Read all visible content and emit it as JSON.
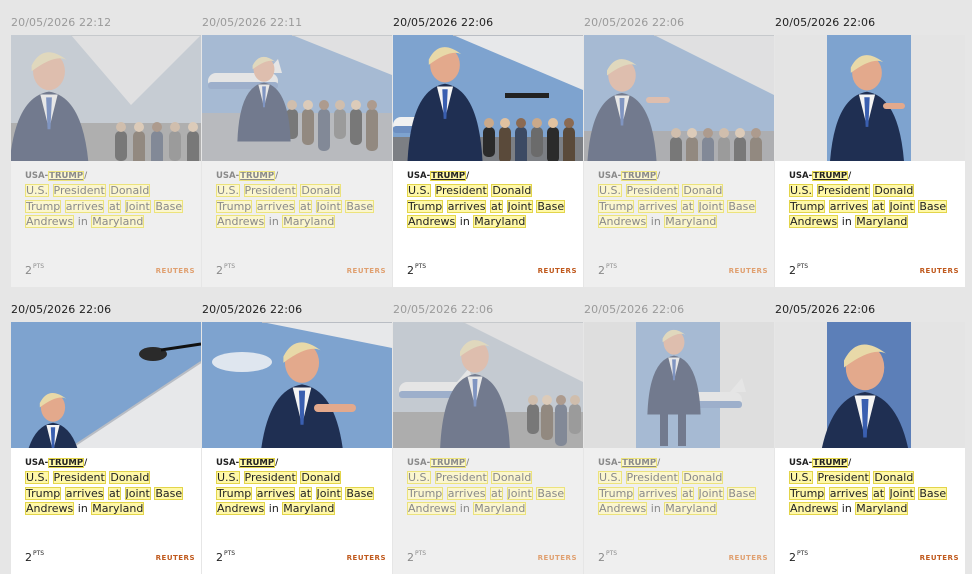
{
  "cards": [
    {
      "timestamp": "20/05/2026 22:12",
      "dimmed": true,
      "photo": "trump-closeup-reporters"
    },
    {
      "timestamp": "20/05/2026 22:11",
      "dimmed": true,
      "photo": "trump-tarmac-press-wide"
    },
    {
      "timestamp": "20/05/2026 22:06",
      "dimmed": false,
      "photo": "trump-under-wing-mics"
    },
    {
      "timestamp": "20/05/2026 22:06",
      "dimmed": true,
      "photo": "trump-gesture-press"
    },
    {
      "timestamp": "20/05/2026 22:06",
      "dimmed": false,
      "photo": "trump-portrait-gesture"
    },
    {
      "timestamp": "20/05/2026 22:06",
      "dimmed": false,
      "photo": "trump-boom-mic"
    },
    {
      "timestamp": "20/05/2026 22:06",
      "dimmed": false,
      "photo": "trump-lowangle-gesture"
    },
    {
      "timestamp": "20/05/2026 22:06",
      "dimmed": true,
      "photo": "trump-tarmac-gesture"
    },
    {
      "timestamp": "20/05/2026 22:06",
      "dimmed": true,
      "photo": "trump-fullbody-portrait"
    },
    {
      "timestamp": "20/05/2026 22:06",
      "dimmed": false,
      "photo": "trump-closeup-portrait"
    }
  ],
  "caption": {
    "slug_prefix": "USA-",
    "slug_keyword": "TRUMP",
    "slug_suffix": "/",
    "words": [
      "U.S.",
      "President",
      "Donald",
      "Trump",
      "arrives",
      "at",
      "Joint",
      "Base",
      "Andrews",
      "in",
      "Maryland"
    ],
    "highlighted": [
      true,
      true,
      true,
      true,
      true,
      true,
      true,
      true,
      true,
      false,
      true
    ]
  },
  "points_value": "2",
  "points_unit": "PTS",
  "source": "REUTERS",
  "colors": {
    "highlight": "#fff8a8",
    "highlight_border": "#e3d54a",
    "source": "#c05a1e",
    "sky": "#7ea3cf",
    "suit": "#1f2f52"
  }
}
